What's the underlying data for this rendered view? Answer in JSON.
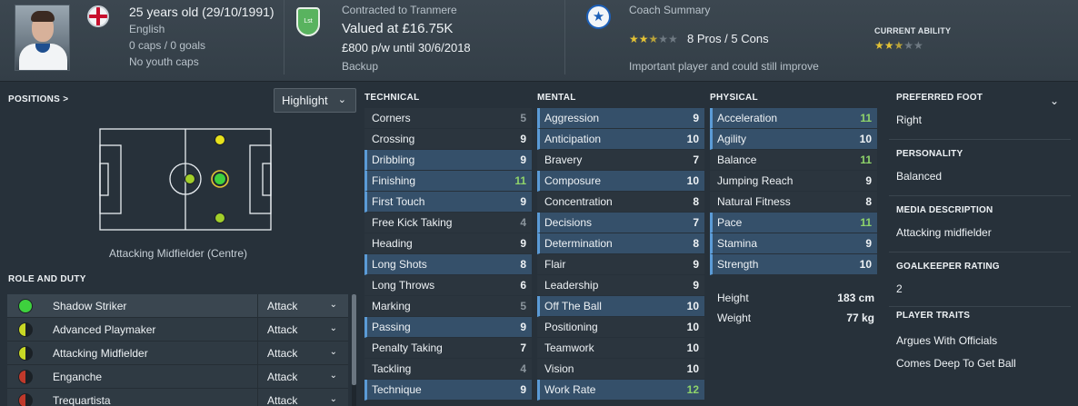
{
  "header": {
    "age": "25 years old (29/10/1991)",
    "nationality": "English",
    "caps": "0 caps / 0 goals",
    "youth_caps": "No youth caps",
    "club_badge": "Lst",
    "contract_title": "Contracted to Tranmere",
    "value": "Valued at £16.75K",
    "wage": "£800 p/w until 30/6/2018",
    "squad_status": "Backup",
    "coach_title": "Coach Summary",
    "coach_stars": 2.5,
    "pros_cons": "8 Pros / 5 Cons",
    "coach_note": "Important player and could still improve",
    "current_ability_label": "CURRENT ABILITY",
    "current_ability_stars": 2.5
  },
  "positions": {
    "title": "POSITIONS >",
    "highlight_label": "Highlight",
    "position_label": "Attacking Midfielder (Centre)"
  },
  "roles": {
    "title": "ROLE AND DUTY",
    "items": [
      {
        "name": "Shadow Striker",
        "duty": "Attack",
        "rating": "natural"
      },
      {
        "name": "Advanced Playmaker",
        "duty": "Attack",
        "rating": "accomplished"
      },
      {
        "name": "Attacking Midfielder",
        "duty": "Attack",
        "rating": "accomplished"
      },
      {
        "name": "Enganche",
        "duty": "Attack",
        "rating": "unconvincing"
      },
      {
        "name": "Trequartista",
        "duty": "Attack",
        "rating": "unconvincing"
      }
    ]
  },
  "attributes": {
    "technical": {
      "title": "TECHNICAL",
      "items": [
        {
          "name": "Corners",
          "value": "5",
          "hl": false
        },
        {
          "name": "Crossing",
          "value": "9",
          "hl": false
        },
        {
          "name": "Dribbling",
          "value": "9",
          "hl": true
        },
        {
          "name": "Finishing",
          "value": "11",
          "hl": true
        },
        {
          "name": "First Touch",
          "value": "9",
          "hl": true
        },
        {
          "name": "Free Kick Taking",
          "value": "4",
          "hl": false
        },
        {
          "name": "Heading",
          "value": "9",
          "hl": false
        },
        {
          "name": "Long Shots",
          "value": "8",
          "hl": true
        },
        {
          "name": "Long Throws",
          "value": "6",
          "hl": false
        },
        {
          "name": "Marking",
          "value": "5",
          "hl": false
        },
        {
          "name": "Passing",
          "value": "9",
          "hl": true
        },
        {
          "name": "Penalty Taking",
          "value": "7",
          "hl": false
        },
        {
          "name": "Tackling",
          "value": "4",
          "hl": false
        },
        {
          "name": "Technique",
          "value": "9",
          "hl": true
        }
      ]
    },
    "mental": {
      "title": "MENTAL",
      "items": [
        {
          "name": "Aggression",
          "value": "9",
          "hl": true
        },
        {
          "name": "Anticipation",
          "value": "10",
          "hl": true
        },
        {
          "name": "Bravery",
          "value": "7",
          "hl": false
        },
        {
          "name": "Composure",
          "value": "10",
          "hl": true
        },
        {
          "name": "Concentration",
          "value": "8",
          "hl": false
        },
        {
          "name": "Decisions",
          "value": "7",
          "hl": true
        },
        {
          "name": "Determination",
          "value": "8",
          "hl": true
        },
        {
          "name": "Flair",
          "value": "9",
          "hl": false
        },
        {
          "name": "Leadership",
          "value": "9",
          "hl": false
        },
        {
          "name": "Off The Ball",
          "value": "10",
          "hl": true
        },
        {
          "name": "Positioning",
          "value": "10",
          "hl": false
        },
        {
          "name": "Teamwork",
          "value": "10",
          "hl": false
        },
        {
          "name": "Vision",
          "value": "10",
          "hl": false
        },
        {
          "name": "Work Rate",
          "value": "12",
          "hl": true
        }
      ]
    },
    "physical": {
      "title": "PHYSICAL",
      "items": [
        {
          "name": "Acceleration",
          "value": "11",
          "hl": true
        },
        {
          "name": "Agility",
          "value": "10",
          "hl": true
        },
        {
          "name": "Balance",
          "value": "11",
          "hl": false
        },
        {
          "name": "Jumping Reach",
          "value": "9",
          "hl": false
        },
        {
          "name": "Natural Fitness",
          "value": "8",
          "hl": false
        },
        {
          "name": "Pace",
          "value": "11",
          "hl": true
        },
        {
          "name": "Stamina",
          "value": "9",
          "hl": true
        },
        {
          "name": "Strength",
          "value": "10",
          "hl": true
        }
      ]
    },
    "height_label": "Height",
    "height_value": "183 cm",
    "weight_label": "Weight",
    "weight_value": "77 kg"
  },
  "info": {
    "foot_label": "PREFERRED FOOT",
    "foot_value": "Right",
    "personality_label": "PERSONALITY",
    "personality_value": "Balanced",
    "media_label": "MEDIA DESCRIPTION",
    "media_value": "Attacking midfielder",
    "gk_label": "GOALKEEPER RATING",
    "gk_value": "2",
    "traits_label": "PLAYER TRAITS",
    "traits": [
      "Argues With Officials",
      "Comes Deep To Get Ball"
    ]
  },
  "colors": {
    "accent": "#5b9bd6",
    "high_value": "#8fd46a",
    "low_value": "#8b959d",
    "natural": "#3ed13e",
    "accomplished": "#c8d825",
    "unconvincing": "#c0392b",
    "star": "#e3c235"
  }
}
